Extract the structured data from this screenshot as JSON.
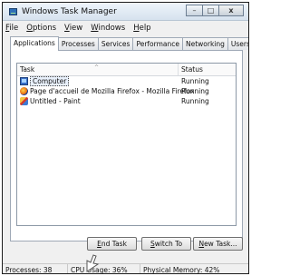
{
  "window": {
    "title": "Windows Task Manager"
  },
  "title_buttons": {
    "minimize": "–",
    "maximize": "□",
    "close": "x"
  },
  "menubar": [
    {
      "mnemonic": "F",
      "rest": "ile"
    },
    {
      "mnemonic": "O",
      "rest": "ptions"
    },
    {
      "mnemonic": "V",
      "rest": "iew"
    },
    {
      "mnemonic": "W",
      "rest": "indows"
    },
    {
      "mnemonic": "H",
      "rest": "elp"
    }
  ],
  "tabs": [
    "Applications",
    "Processes",
    "Services",
    "Performance",
    "Networking",
    "Users"
  ],
  "list": {
    "columns": {
      "task": "Task",
      "status": "Status"
    },
    "sort_glyph": "^",
    "rows": [
      {
        "icon": "computer-icon",
        "task": "Computer",
        "status": "Running"
      },
      {
        "icon": "firefox-icon",
        "task": "Page d'accueil de Mozilla Firefox - Mozilla Firefox",
        "status": "Running"
      },
      {
        "icon": "paint-icon",
        "task": "Untitled - Paint",
        "status": "Running"
      }
    ]
  },
  "buttons": {
    "end_task": {
      "mnemonic": "E",
      "rest": "nd Task"
    },
    "switch_to": {
      "mnemonic": "S",
      "rest": "witch To"
    },
    "new_task": {
      "mnemonic": "N",
      "rest": "ew Task..."
    }
  },
  "statusbar": {
    "processes": "Processes: 38",
    "cpu_usage": "CPU Usage: 36%",
    "physical_memory": "Physical Memory: 42%"
  },
  "colors": {
    "accent": "#2e6fb8",
    "selection": "#e8f0fb"
  }
}
